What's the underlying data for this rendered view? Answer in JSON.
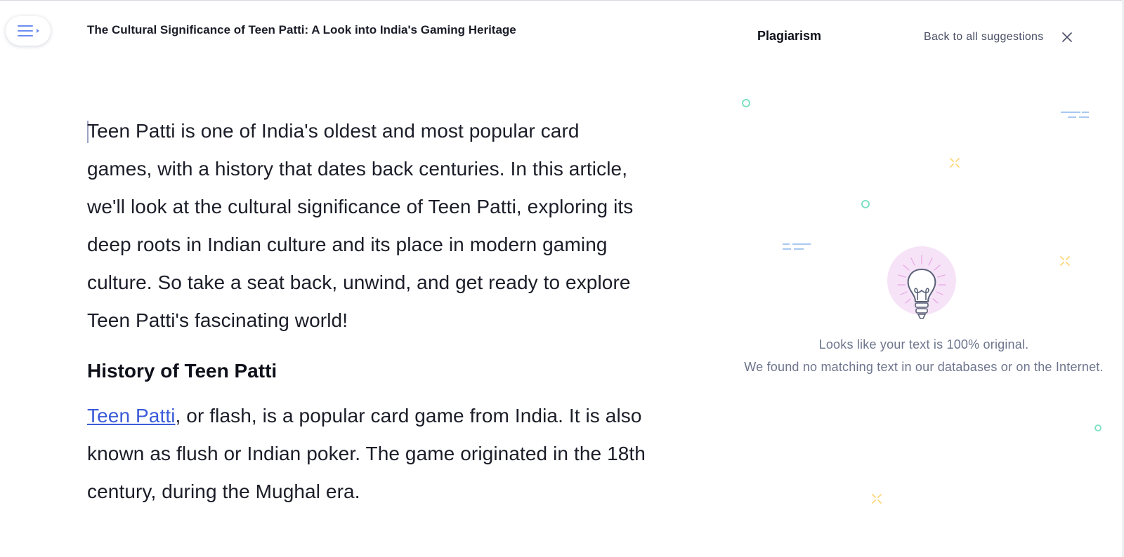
{
  "document": {
    "title": "The Cultural Significance of Teen Patti: A Look into India's Gaming Heritage",
    "intro": "Teen Patti is one of India's oldest and most popular card games, with a history that dates back centuries. In this article, we'll look at the cultural significance of Teen Patti, exploring its deep roots in Indian culture and its place in modern gaming culture. So take a seat back, unwind, and get ready to explore Teen Patti's fascinating world!",
    "section_heading": "History of Teen Patti",
    "section_link": "Teen Patti",
    "section_text": ", or flash, is a popular card game from India. It is also known as flush or Indian poker. The game originated in the 18th century, during the Mughal era."
  },
  "panel": {
    "title": "Plagiarism",
    "back_label": "Back to all suggestions",
    "result_line1": "Looks like your text is 100% original.",
    "result_line2": "We found no matching text in our databases or on the Internet."
  },
  "icons": {
    "menu": "menu-icon",
    "close": "close-icon",
    "illustration": "lightbulb-icon"
  },
  "colors": {
    "link": "#3b5bd9",
    "muted_text": "#6d758d",
    "bulb_bg": "#f6e3f7",
    "deco_green": "#7ee0c3",
    "deco_blue": "#a8c8f0",
    "deco_yellow": "#ffd67a"
  }
}
